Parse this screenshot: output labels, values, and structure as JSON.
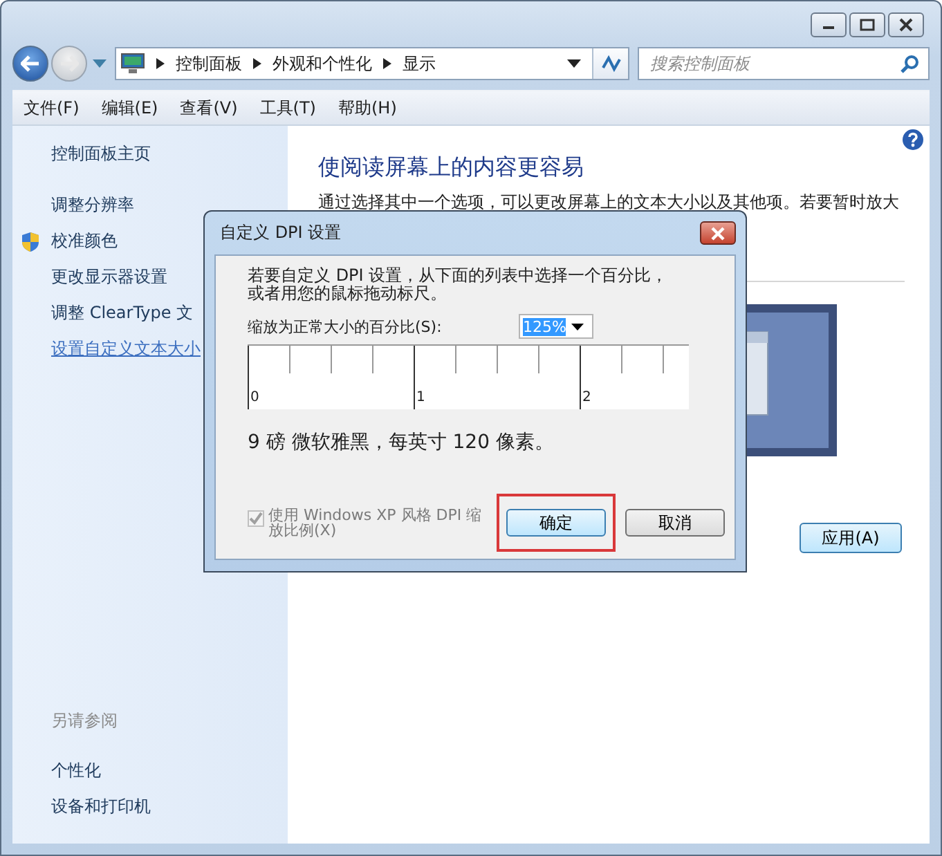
{
  "address_bar": {
    "breadcrumbs": [
      "控制面板",
      "外观和个性化",
      "显示"
    ]
  },
  "search": {
    "placeholder": "搜索控制面板"
  },
  "menu": [
    "文件(F)",
    "编辑(E)",
    "查看(V)",
    "工具(T)",
    "帮助(H)"
  ],
  "sidebar": {
    "home": "控制面板主页",
    "links": [
      {
        "label": "调整分辨率",
        "shield": false,
        "hover": false
      },
      {
        "label": "校准颜色",
        "shield": true,
        "hover": false
      },
      {
        "label": "更改显示器设置",
        "shield": false,
        "hover": false
      },
      {
        "label": "调整 ClearType 文",
        "shield": false,
        "hover": false
      },
      {
        "label": "设置自定义文本大小",
        "shield": false,
        "hover": true
      }
    ],
    "see_also": {
      "title": "另请参阅",
      "links": [
        "个性化",
        "设备和打印机"
      ]
    }
  },
  "main": {
    "heading": "使阅读屏幕上的内容更容易",
    "description": "通过选择其中一个选项，可以更改屏幕上的文本大小以及其他项。若要暂时放大",
    "apply_button": "应用(A)"
  },
  "dialog": {
    "title": "自定义 DPI 设置",
    "instructions": "若要自定义 DPI 设置，从下面的列表中选择一个百分比，或者用您的鼠标拖动标尺。",
    "scale_label": "缩放为正常大小的百分比(S):",
    "scale_value": "125%",
    "ruler_labels": [
      "0",
      "1",
      "2"
    ],
    "sample_text": "9 磅 微软雅黑，每英寸 120 像素。",
    "xp_checkbox": {
      "label": "使用 Windows XP 风格 DPI 缩放比例(X)",
      "checked": true,
      "disabled": true
    },
    "buttons": [
      {
        "label": "确定",
        "highlighted": true
      },
      {
        "label": "取消",
        "highlighted": false
      }
    ]
  }
}
